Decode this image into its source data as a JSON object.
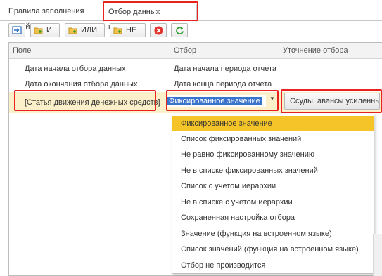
{
  "tabs": {
    "rules": "Правила заполнения полей",
    "filter": "Отбор данных источника"
  },
  "toolbar": {
    "and": "И",
    "or": "ИЛИ",
    "not": "НЕ"
  },
  "colors": {
    "highlight_frame": "#e8231e",
    "selected_row": "#fbf0c9",
    "active_option": "#f5c428",
    "selection": "#3a73cc"
  },
  "table": {
    "headers": [
      "Поле",
      "Отбор",
      "Уточнение отбора"
    ],
    "rows": [
      {
        "field": "Дата начала отбора данных",
        "filter": "Дата начала периода отчета",
        "refine": ""
      },
      {
        "field": "Дата окончания отбора данных",
        "filter": "Дата конца периода отчета",
        "refine": ""
      },
      {
        "field": "[Статья движения денежных средств]",
        "filter": "Фиксированное значение",
        "refine": "Ссуды, авансы усиленные"
      }
    ]
  },
  "dropdown": {
    "options": [
      "Фиксированное значение",
      "Список фиксированных значений",
      "Не равно фиксированному значению",
      "Не в списке фиксированных значений",
      "Список с учетом иерархии",
      "Не в списке с учетом иерархии",
      "Сохраненная настройка отбора",
      "Значение (функция на встроенном языке)",
      "Список значений (функция на встроенном языке)",
      "Отбор не производится"
    ]
  }
}
